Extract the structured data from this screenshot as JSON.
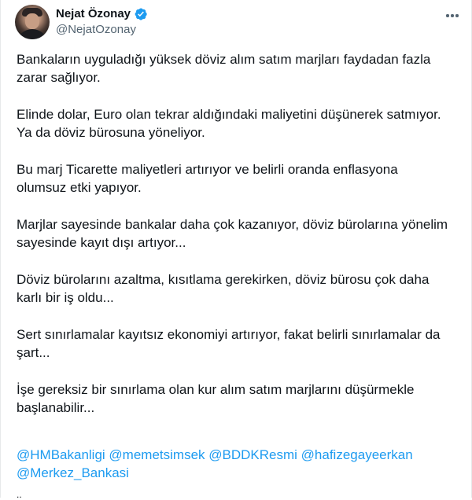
{
  "author": {
    "display_name": "Nejat Özonay",
    "handle": "@NejatOzonay",
    "verified": true,
    "verified_color": "#1d9bf0"
  },
  "more_icon": "more-horizontal-icon",
  "paragraphs": [
    "Bankaların uyguladığı yüksek döviz alım satım marjları faydadan fazla\nzarar sağlıyor.",
    "Elinde dolar, Euro olan tekrar aldığındaki maliyetini düşünerek satmıyor.\nYa da döviz bürosuna yöneliyor.",
    "Bu marj Ticarette maliyetleri artırıyor ve belirli oranda enflasyona\nolumsuz etki yapıyor.",
    "Marjlar sayesinde bankalar daha çok kazanıyor, döviz bürolarına yönelim\nsayesinde kayıt dışı artıyor...",
    "Döviz bürolarını azaltma, kısıtlama gerekirken, döviz bürosu çok daha\nkarlı bir iş oldu...",
    "Sert sınırlamalar kayıtsız ekonomiyi artırıyor, fakat belirli sınırlamalar da\nşart...",
    "İşe gereksiz bir sınırlama olan kur alım satım marjlarını düşürmekle\nbaşlanabilir..."
  ],
  "mentions": [
    "@HMBakanligi",
    "@memetsimsek",
    "@BDDKResmi",
    "@hafizegayeerkan",
    "@Merkez_Bankasi"
  ],
  "trailing_text": "..",
  "colors": {
    "text": "#0f1419",
    "secondary": "#536471",
    "link": "#1d9bf0",
    "border": "#e7e9ea"
  }
}
